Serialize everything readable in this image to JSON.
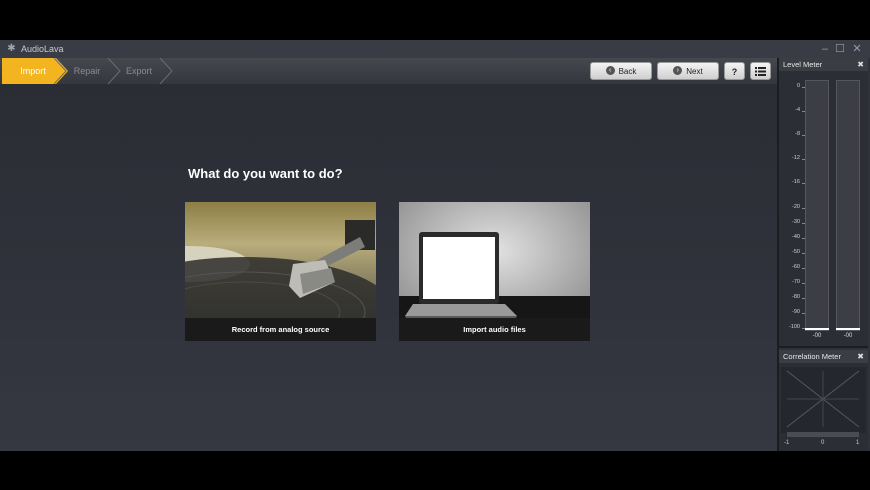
{
  "window": {
    "title": "AudioLava",
    "app_icon": "audiolava-logo-icon",
    "controls": [
      "minimize-icon",
      "maximize-icon",
      "close-icon"
    ]
  },
  "steps": [
    {
      "label": "Import",
      "active": true
    },
    {
      "label": "Repair",
      "active": false
    },
    {
      "label": "Export",
      "active": false
    }
  ],
  "toolbar": {
    "back_label": "Back",
    "next_label": "Next",
    "help_label": "?",
    "menu_icon": "list-icon"
  },
  "main": {
    "question": "What do you want to do?",
    "options": [
      {
        "label": "Record from analog source",
        "image": "turntable-photo"
      },
      {
        "label": "Import audio files",
        "image": "laptop-photo"
      }
    ]
  },
  "level_meter": {
    "title": "Level Meter",
    "ticks": [
      "0",
      "-4",
      "-8",
      "-12",
      "-16",
      "-20",
      "-30",
      "-40",
      "-50",
      "-60",
      "-70",
      "-80",
      "-90",
      "-100"
    ],
    "channel_readouts": [
      "-00",
      "-00"
    ]
  },
  "correlation_meter": {
    "title": "Correlation Meter",
    "scale": [
      "-1",
      "0",
      "1"
    ]
  },
  "colors": {
    "accent": "#f2b51f",
    "background": "#2f313b"
  }
}
